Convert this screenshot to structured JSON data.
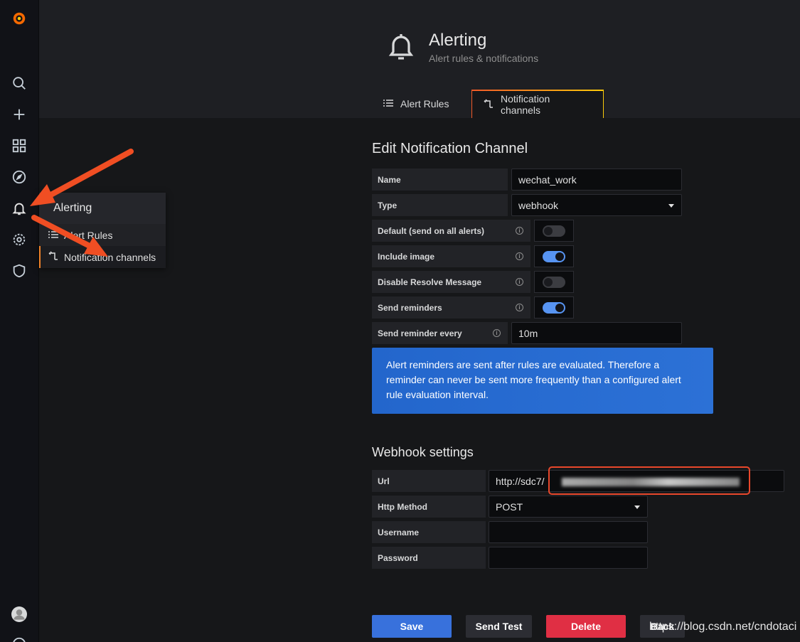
{
  "header": {
    "title": "Alerting",
    "subtitle": "Alert rules & notifications",
    "tabs": [
      {
        "label": "Alert Rules",
        "icon": "list-icon"
      },
      {
        "label": "Notification channels",
        "icon": "channels-icon"
      }
    ]
  },
  "flyout": {
    "title": "Alerting",
    "items": [
      {
        "label": "Alert Rules",
        "icon": "list-icon"
      },
      {
        "label": "Notification channels",
        "icon": "channels-icon"
      }
    ]
  },
  "form": {
    "section_title": "Edit Notification Channel",
    "name_label": "Name",
    "name_value": "wechat_work",
    "type_label": "Type",
    "type_value": "webhook",
    "default_label": "Default (send on all alerts)",
    "default_on": false,
    "include_image_label": "Include image",
    "include_image_on": true,
    "disable_resolve_label": "Disable Resolve Message",
    "disable_resolve_on": false,
    "send_reminders_label": "Send reminders",
    "send_reminders_on": true,
    "reminder_every_label": "Send reminder every",
    "reminder_every_value": "10m",
    "info_text": "Alert reminders are sent after rules are evaluated. Therefore a reminder can never be sent more frequently than a configured alert rule evaluation interval."
  },
  "webhook": {
    "section_title": "Webhook settings",
    "url_label": "Url",
    "url_value": "http://sdc7/",
    "method_label": "Http Method",
    "method_value": "POST",
    "username_label": "Username",
    "username_value": "",
    "password_label": "Password",
    "password_value": ""
  },
  "buttons": {
    "save": "Save",
    "send_test": "Send Test",
    "delete": "Delete",
    "back": "Back"
  },
  "colors": {
    "save": "#3871dc",
    "delete": "#e02f44",
    "secondary": "#2c2d33",
    "toggle_on": "#5794f2"
  },
  "watermark": "https://blog.csdn.net/cndotaci"
}
